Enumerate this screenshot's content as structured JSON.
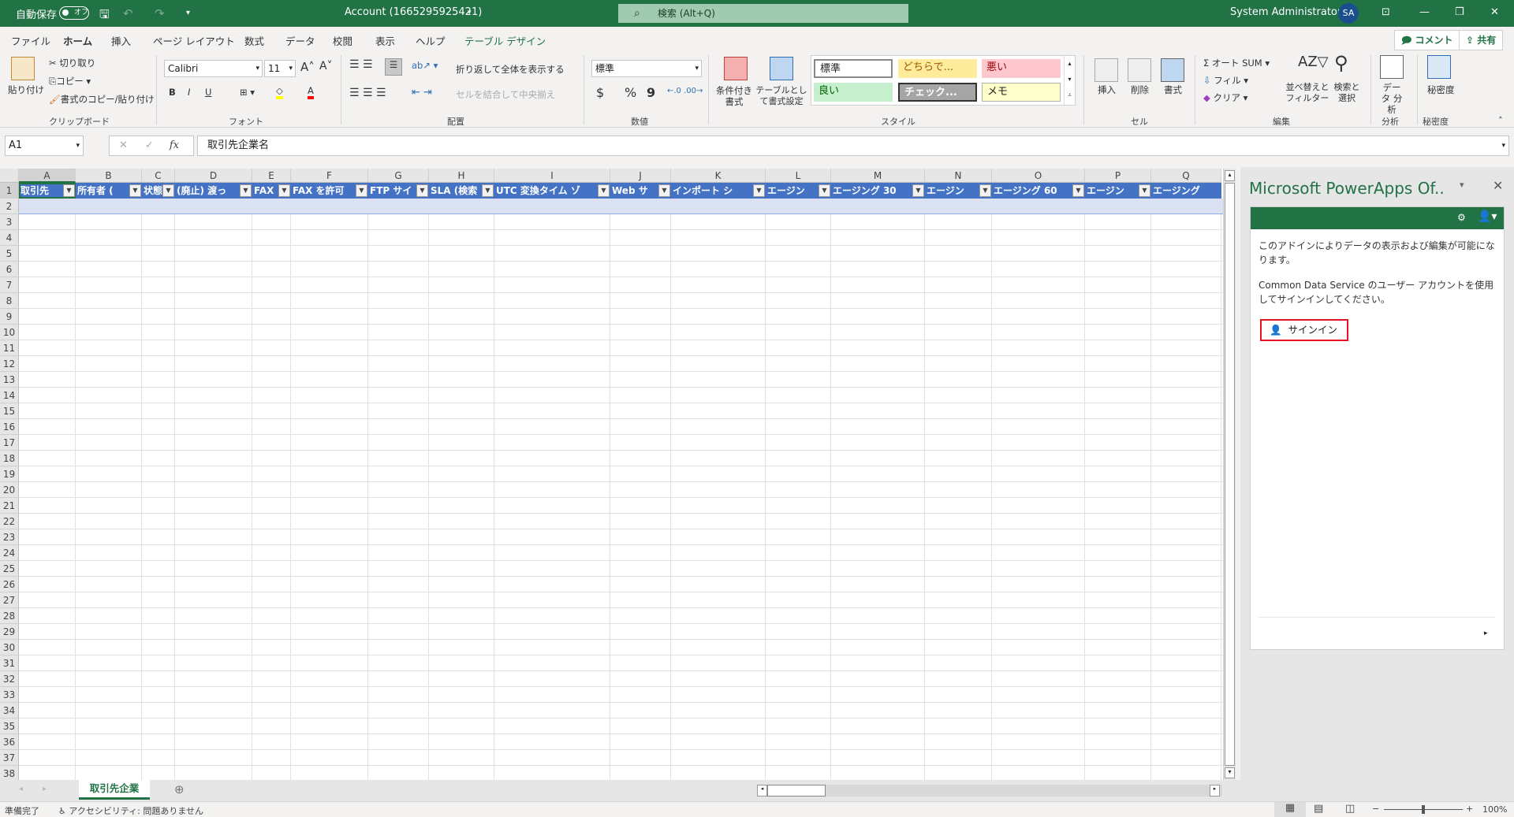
{
  "titlebar": {
    "autosave_label": "自動保存",
    "autosave_state": "オフ",
    "doc_title": "Account (1665295925421)",
    "search_placeholder": "検索 (Alt+Q)",
    "user_name": "System Administrator",
    "user_initials": "SA"
  },
  "tabs": [
    {
      "label": "ファイル"
    },
    {
      "label": "ホーム",
      "active": true
    },
    {
      "label": "挿入"
    },
    {
      "label": "ページ レイアウト"
    },
    {
      "label": "数式"
    },
    {
      "label": "データ"
    },
    {
      "label": "校閲"
    },
    {
      "label": "表示"
    },
    {
      "label": "ヘルプ"
    },
    {
      "label": "テーブル デザイン"
    }
  ],
  "ribbon_buttons": {
    "comment": "コメント",
    "share": "共有"
  },
  "ribbon": {
    "clipboard": {
      "paste": "貼り付け",
      "cut": "切り取り",
      "copy": "コピー",
      "format_painter": "書式のコピー/貼り付け",
      "label": "クリップボード"
    },
    "font": {
      "name": "Calibri",
      "size": "11",
      "bold": "B",
      "italic": "I",
      "underline": "U",
      "label": "フォント"
    },
    "alignment": {
      "wrap": "折り返して全体を表示する",
      "merge": "セルを結合して中央揃え",
      "label": "配置"
    },
    "number": {
      "format": "標準",
      "currency": "$",
      "percent": "%",
      "comma": "9",
      "label": "数値"
    },
    "styles": {
      "conditional": "条件付き書式",
      "table": "テーブルとして書式設定",
      "items": [
        {
          "label": "標準",
          "bg": "#ffffff",
          "fg": "#000000"
        },
        {
          "label": "どちらで...",
          "bg": "#ffeb9c",
          "fg": "#9c5700"
        },
        {
          "label": "悪い",
          "bg": "#ffc7ce",
          "fg": "#9c0006"
        },
        {
          "label": "良い",
          "bg": "#c6efce",
          "fg": "#006100"
        },
        {
          "label": "チェック...",
          "bg": "#a5a5a5",
          "fg": "#ffffff"
        },
        {
          "label": "メモ",
          "bg": "#ffffcc",
          "fg": "#000000"
        }
      ],
      "label": "スタイル"
    },
    "cells": {
      "insert": "挿入",
      "delete": "削除",
      "format": "書式",
      "label": "セル"
    },
    "editing": {
      "autosum": "オート SUM",
      "fill": "フィル",
      "clear": "クリア",
      "sort": "並べ替えと フィルター",
      "find": "検索と 選択",
      "label": "編集"
    },
    "analysis": {
      "analyze": "データ 分析",
      "label": "分析"
    },
    "sensitivity": {
      "button": "秘密度",
      "label": "秘密度"
    }
  },
  "formula_bar": {
    "name_box": "A1",
    "fx": "fx",
    "value": "取引先企業名"
  },
  "grid": {
    "columns": [
      "A",
      "B",
      "C",
      "D",
      "E",
      "F",
      "G",
      "H",
      "I",
      "J",
      "K",
      "L",
      "M",
      "N",
      "O",
      "P",
      "Q"
    ],
    "headers": [
      "取引先",
      "所有者 (",
      "状態",
      "(廃止) 渡っ",
      "FAX",
      "FAX を許可",
      "FTP サイ",
      "SLA (検索",
      "UTC 変換タイム ゾ",
      "Web サ",
      "インポート シ",
      "エージン",
      "エージング 30",
      "エージン",
      "エージング 60",
      "エージン",
      "エージング"
    ],
    "row_count": 38
  },
  "pane": {
    "title": "Microsoft PowerApps Of..",
    "text1": "このアドインによりデータの表示および編集が可能になります。",
    "text2": "Common Data Service のユーザー アカウントを使用してサインインしてください。",
    "signin": "サインイン"
  },
  "sheets": [
    {
      "label": "取引先企業",
      "active": true
    }
  ],
  "status": {
    "ready": "準備完了",
    "accessibility": "アクセシビリティ: 問題ありません",
    "zoom": "100%"
  },
  "colors": {
    "brand": "#217346",
    "table_header": "#4472c4",
    "band": "#d9e1f2"
  }
}
